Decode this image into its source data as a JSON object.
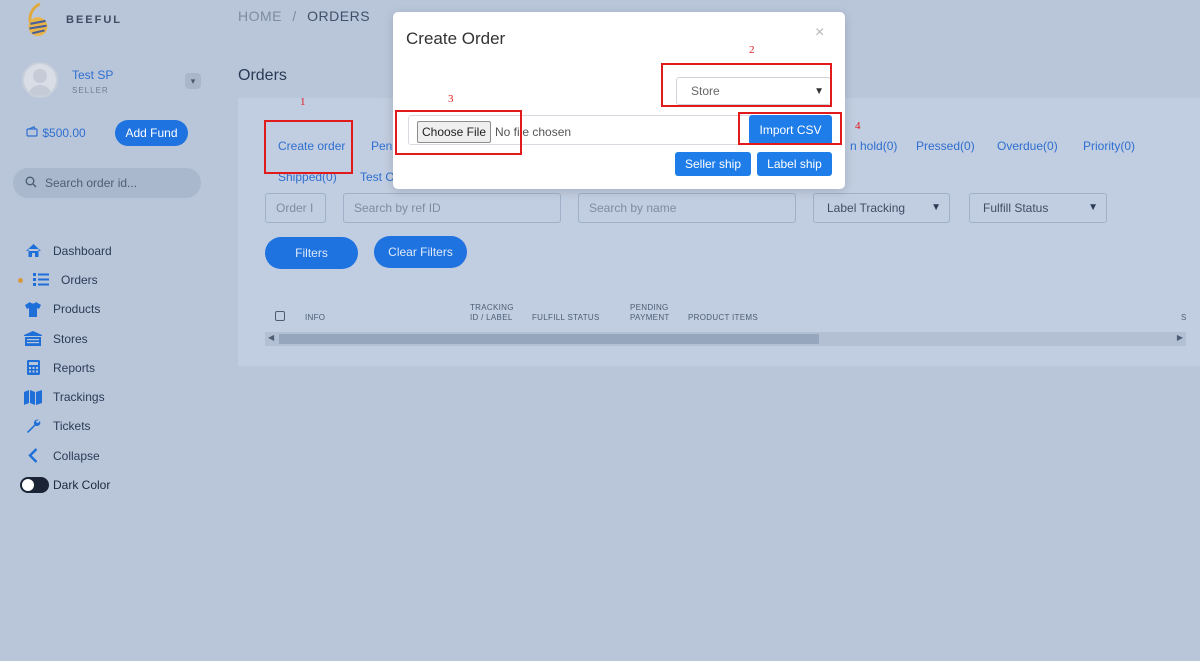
{
  "brand": {
    "name": "BEEFUL"
  },
  "user": {
    "name": "Test SP",
    "role": "SELLER"
  },
  "wallet": {
    "balance": "$500.00",
    "add_fund_label": "Add Fund"
  },
  "sidebar_search": {
    "placeholder": "Search order id..."
  },
  "nav": [
    {
      "label": "Dashboard",
      "icon": "home-icon"
    },
    {
      "label": "Orders",
      "icon": "list-icon",
      "active": true
    },
    {
      "label": "Products",
      "icon": "tshirt-icon"
    },
    {
      "label": "Stores",
      "icon": "store-icon"
    },
    {
      "label": "Reports",
      "icon": "calculator-icon"
    },
    {
      "label": "Trackings",
      "icon": "map-icon"
    },
    {
      "label": "Tickets",
      "icon": "wrench-icon"
    },
    {
      "label": "Collapse",
      "icon": "chevron-left-icon"
    }
  ],
  "dark_mode": {
    "label": "Dark Color"
  },
  "breadcrumb": {
    "home": "HOME",
    "separator": "/",
    "current": "ORDERS"
  },
  "page": {
    "title": "Orders"
  },
  "status_tabs": {
    "create_order": "Create order",
    "pending_partial": "Pend",
    "on_hold": "n hold(0)",
    "pressed": "Pressed(0)",
    "overdue": "Overdue(0)",
    "priority": "Priority(0)",
    "shipped": "Shipped(0)",
    "test_partial": "Test O"
  },
  "filters": {
    "order_id_placeholder": "Order I",
    "ref_id_placeholder": "Search by ref ID",
    "name_placeholder": "Search by name",
    "label_tracking": "Label Tracking",
    "fulfill_status": "Fulfill Status",
    "filters_button": "Filters",
    "clear_button": "Clear Filters"
  },
  "table": {
    "headers": {
      "info": "INFO",
      "tracking_line1": "TRACKING",
      "tracking_line2": "ID / LABEL",
      "fulfill": "FULFILL STATUS",
      "pending_line1": "PENDING",
      "pending_line2": "PAYMENT",
      "product_items": "PRODUCT ITEMS",
      "truncated": "S"
    }
  },
  "modal": {
    "title": "Create Order",
    "close": "×",
    "store_select": "Store",
    "choose_file": "Choose File",
    "no_file": "No file chosen",
    "import_csv": "Import CSV",
    "seller_ship": "Seller ship",
    "label_ship": "Label ship"
  },
  "annotations": {
    "a1": "1",
    "a2": "2",
    "a3": "3",
    "a4": "4"
  },
  "colors": {
    "accent": "#1f73e0",
    "annotation": "#e11b1b",
    "background": "#b9c6da"
  }
}
